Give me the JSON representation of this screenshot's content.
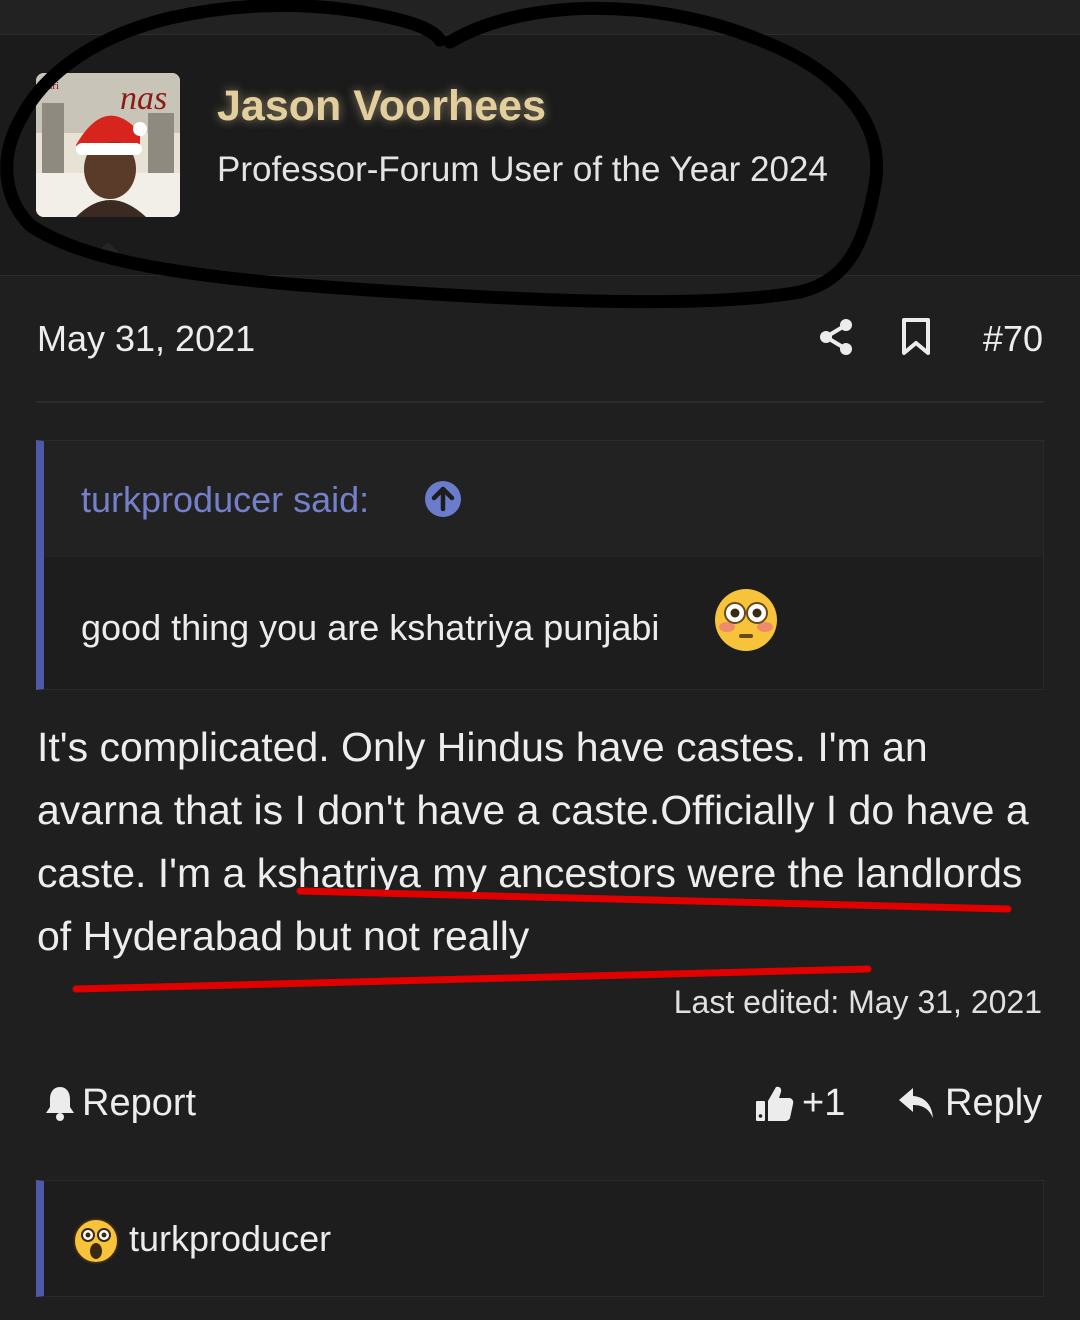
{
  "post": {
    "author": "Jason Voorhees",
    "user_title": "Professor-Forum User of the Year 2024",
    "avatar_text": "nas",
    "avatar_small_text": "chri",
    "date": "May 31, 2021",
    "number": "#70"
  },
  "quote": {
    "author_label": "turkproducer said:",
    "text": "good thing you are kshatriya punjabi"
  },
  "body": {
    "part1": "It's complicated. Only Hindus have castes. I'm an avarna that is I don't have a caste.Officially I do have a caste. ",
    "part2": "I'm a kshatriya my ancestors were the landlords of Hyderabad but not really"
  },
  "last_edited": "Last edited: May 31, 2021",
  "actions": {
    "report": "Report",
    "like_count": "+1",
    "reply": "Reply"
  },
  "reactions": {
    "user": "turkproducer"
  },
  "colors": {
    "background": "#1f1f1f",
    "username": "#e3cf9d",
    "quote_accent": "#4e5aa8",
    "quote_author": "#7480c9",
    "annotation_black": "#000000",
    "annotation_red": "#e00000"
  },
  "icons": [
    "share-icon",
    "bookmark-icon",
    "arrow-up-circle-icon",
    "bell-icon",
    "thumbs-up-icon",
    "reply-arrow-icon",
    "flushed-face-emoji",
    "astonished-face-emoji"
  ]
}
